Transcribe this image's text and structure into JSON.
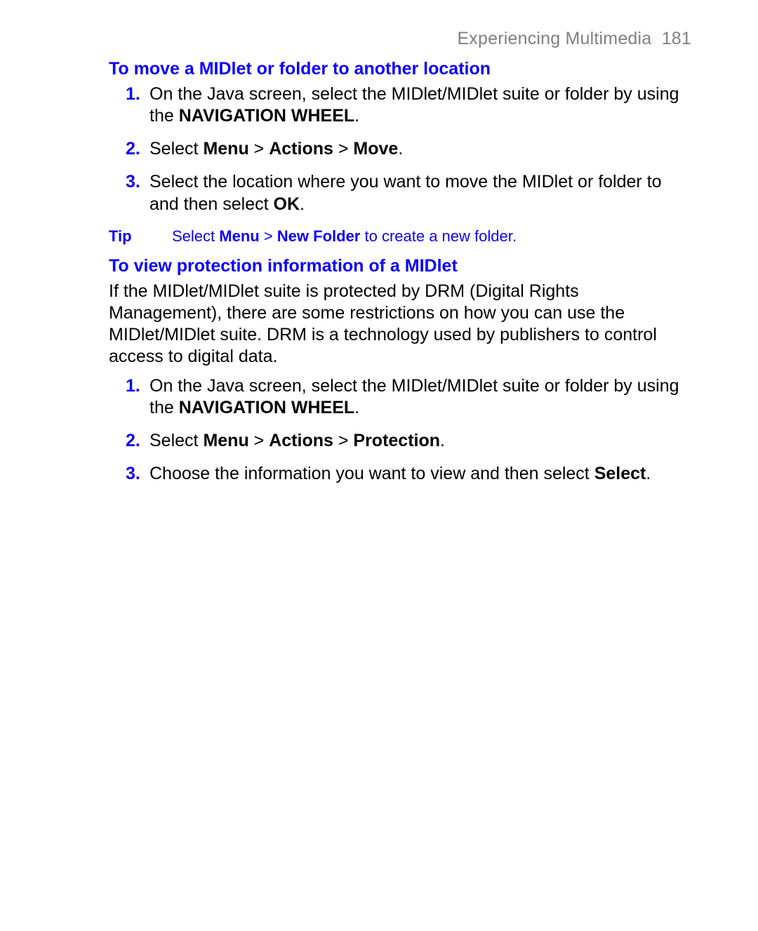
{
  "header": {
    "chapter": "Experiencing Multimedia",
    "pageno": "181"
  },
  "section1": {
    "heading": "To move a MIDlet or folder to another location",
    "steps": [
      {
        "pre": "On the Java screen, select the MIDlet/MIDlet suite or folder  by using the ",
        "b1": "NAVIGATION WHEEL",
        "post": "."
      },
      {
        "pre": "Select ",
        "b1": "Menu",
        "mid1": " > ",
        "b2": "Actions",
        "mid2": " > ",
        "b3": "Move",
        "post": "."
      },
      {
        "pre": "Select the location where you want to move the MIDlet or folder to and then select ",
        "b1": "OK",
        "post": "."
      }
    ]
  },
  "tip": {
    "label": "Tip",
    "pre": "Select ",
    "b1": "Menu",
    "mid1": " > ",
    "b2": "New Folder",
    "post": " to create a new folder."
  },
  "section2": {
    "heading": "To view protection information of a MIDlet",
    "para": "If the MIDlet/MIDlet suite is protected by DRM (Digital Rights Management), there are some restrictions on how you can use the MIDlet/MIDlet suite. DRM is a technology used by publishers to control access to digital data.",
    "steps": [
      {
        "pre": "On the Java screen, select the MIDlet/MIDlet suite or folder  by using the ",
        "b1": "NAVIGATION WHEEL",
        "post": "."
      },
      {
        "pre": "Select ",
        "b1": "Menu",
        "mid1": " > ",
        "b2": "Actions",
        "mid2": " > ",
        "b3": "Protection",
        "post": "."
      },
      {
        "pre": "Choose the information you want to view and then select ",
        "b1": "Select",
        "post": "."
      }
    ]
  }
}
